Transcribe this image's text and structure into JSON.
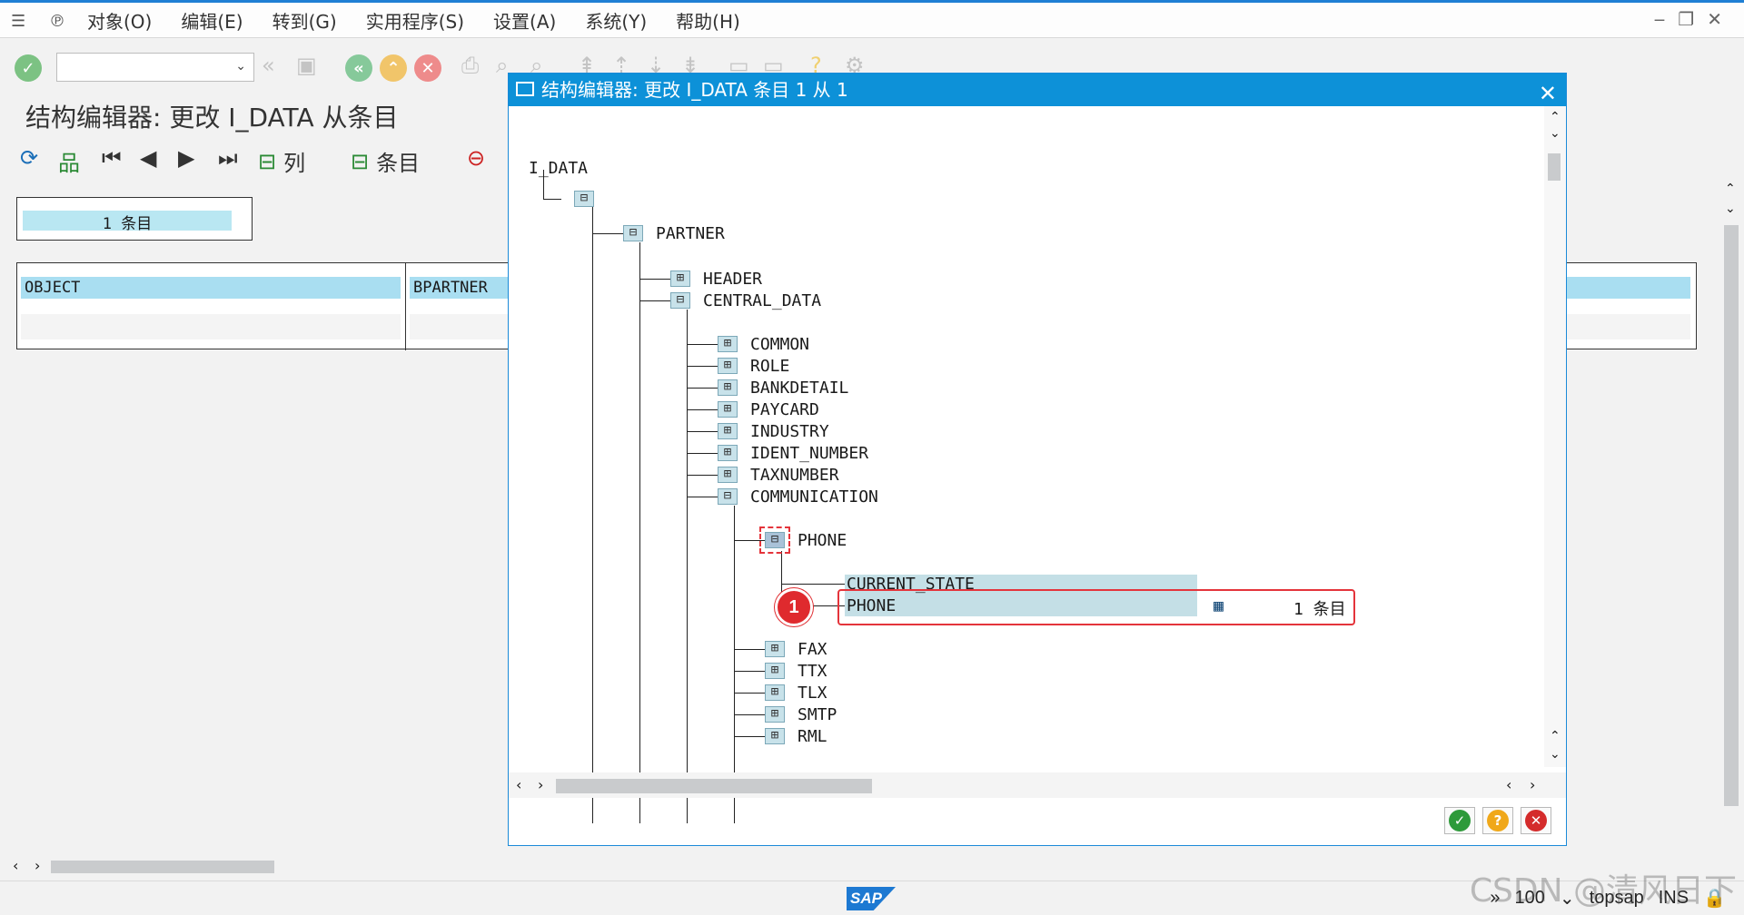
{
  "menu": {
    "items": [
      "对象(O)",
      "编辑(E)",
      "转到(G)",
      "实用程序(S)",
      "设置(A)",
      "系统(Y)",
      "帮助(H)"
    ]
  },
  "page": {
    "title": "结构编辑器: 更改 I_DATA 从条目"
  },
  "appbar": {
    "columns_label": "列",
    "entries_label": "条目"
  },
  "background": {
    "count": "1 条目",
    "col1": "OBJECT",
    "col2": "BPARTNER"
  },
  "dialog": {
    "title": "结构编辑器: 更改 I_DATA 条目 1 从 1",
    "root": "I_DATA",
    "nodes": {
      "partner": "PARTNER",
      "header": "HEADER",
      "central_data": "CENTRAL_DATA",
      "common": "COMMON",
      "role": "ROLE",
      "bankdetail": "BANKDETAIL",
      "paycard": "PAYCARD",
      "industry": "INDUSTRY",
      "ident_number": "IDENT_NUMBER",
      "taxnumber": "TAXNUMBER",
      "communication": "COMMUNICATION",
      "phone": "PHONE",
      "current_state": "CURRENT_STATE",
      "phone_child": "PHONE",
      "phone_count": "1 条目",
      "fax": "FAX",
      "ttx": "TTX",
      "tlx": "TLX",
      "smtp": "SMTP",
      "rml": "RML"
    },
    "badge": "1"
  },
  "status": {
    "zoom": "100",
    "system": "topsap",
    "mode": "INS"
  },
  "watermark": "CSDN @清风日下",
  "colors": {
    "title_bar": "#0d91d8",
    "highlight": "#e4343b",
    "header_cell": "#a9def1"
  }
}
